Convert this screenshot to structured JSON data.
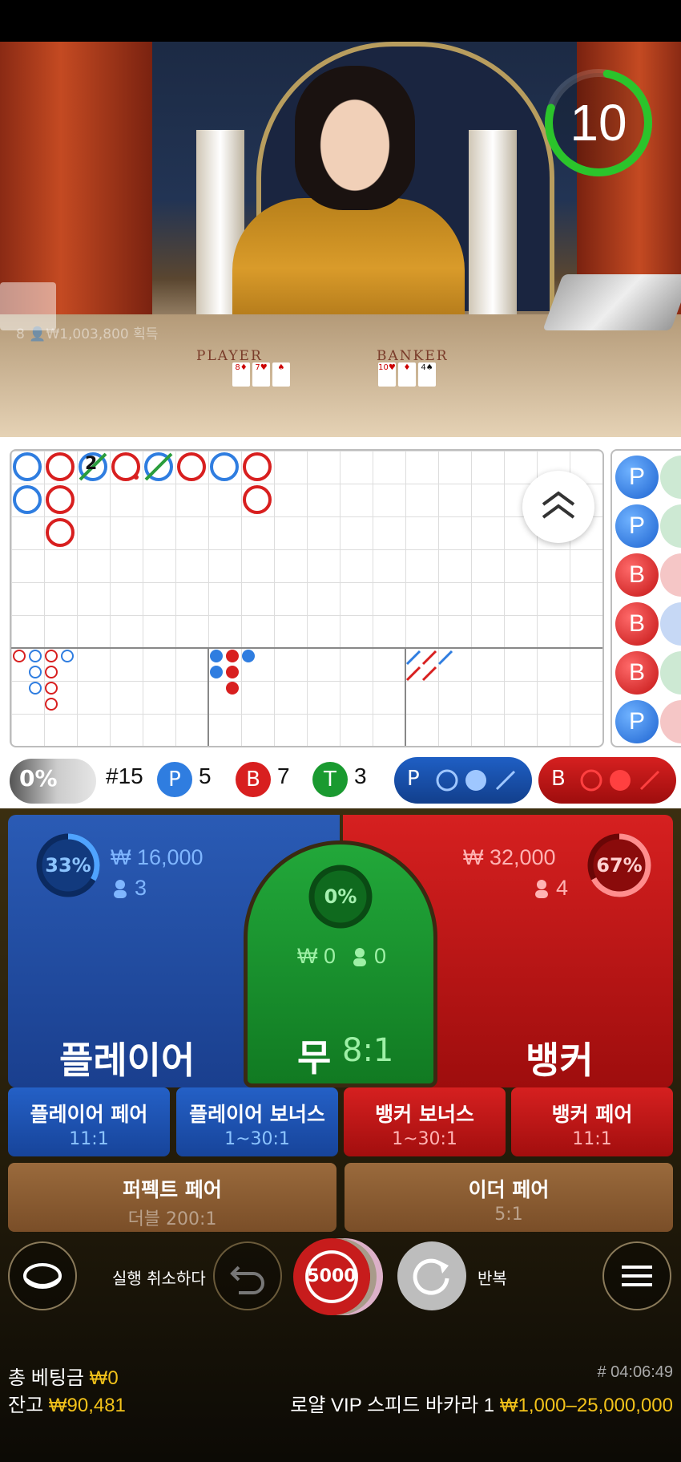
{
  "video": {
    "timer": "10",
    "win_message": "8 👤₩1,003,800 획득",
    "table_player_label": "PLAYER",
    "table_banker_label": "BANKER"
  },
  "roads": {
    "tie_count_label": "2",
    "prediction_column": [
      "P",
      "P",
      "B",
      "B",
      "B",
      "P"
    ]
  },
  "stats": {
    "percent": "0%",
    "round": "#15",
    "player_letter": "P",
    "player_count": "5",
    "banker_letter": "B",
    "banker_count": "7",
    "tie_letter": "T",
    "tie_count": "3",
    "ask_player": "P",
    "ask_banker": "B"
  },
  "bets": {
    "player": {
      "percent": "33%",
      "amount": "₩ 16,000",
      "players": "3",
      "label": "플레이어"
    },
    "tie": {
      "percent": "0%",
      "amount": "₩ 0",
      "players": "0",
      "label": "무",
      "odds": "8:1"
    },
    "banker": {
      "percent": "67%",
      "amount": "₩ 32,000",
      "players": "4",
      "label": "뱅커"
    },
    "side": [
      {
        "title": "플레이어 페어",
        "odds": "11:1"
      },
      {
        "title": "플레이어 보너스",
        "odds": "1~30:1"
      },
      {
        "title": "뱅커 보너스",
        "odds": "1~30:1"
      },
      {
        "title": "뱅커 페어",
        "odds": "11:1"
      }
    ],
    "perfect_pair": {
      "title": "퍼펙트 페어",
      "odds": "더블 200:1"
    },
    "either_pair": {
      "title": "이더 페어",
      "odds": "5:1"
    }
  },
  "controls": {
    "undo_label": "실행 취소하다",
    "chip_value": "5000",
    "repeat_label": "반복"
  },
  "footer": {
    "total_bet_label": "총 베팅금",
    "total_bet_value": "₩0",
    "balance_label": "잔고",
    "balance_value": "₩90,481",
    "round_id": "# 04:06:49",
    "table_name": "로얄 VIP 스피드 바카라 1",
    "limits": "₩1,000–25,000,000"
  },
  "colors": {
    "player_blue": "#1f5fc4",
    "banker_red": "#c81414",
    "tie_green": "#1a9a30",
    "gold": "#f2c21a"
  }
}
